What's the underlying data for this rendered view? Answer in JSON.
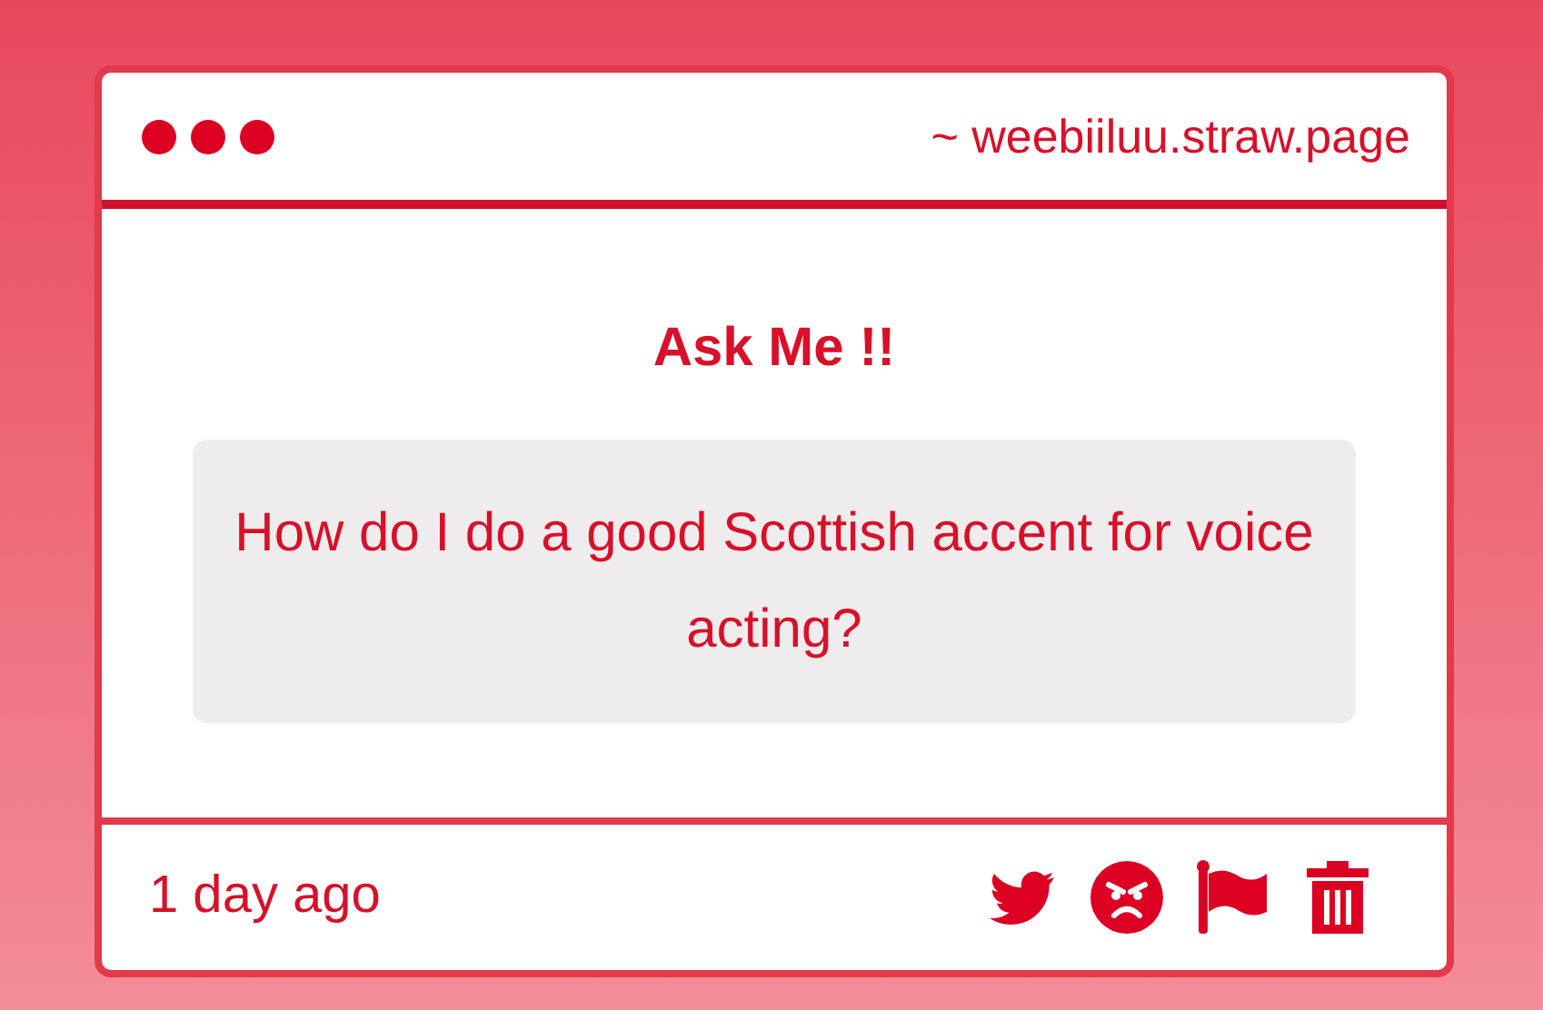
{
  "window": {
    "title": "~ weebiiluu.straw.page"
  },
  "heading": "Ask Me !!",
  "question": "How do I do a good Scottish accent for voice acting?",
  "footer": {
    "time": "1 day ago",
    "actions": [
      {
        "kind": "twitter"
      },
      {
        "kind": "angry"
      },
      {
        "kind": "flag"
      },
      {
        "kind": "trash"
      }
    ]
  }
}
